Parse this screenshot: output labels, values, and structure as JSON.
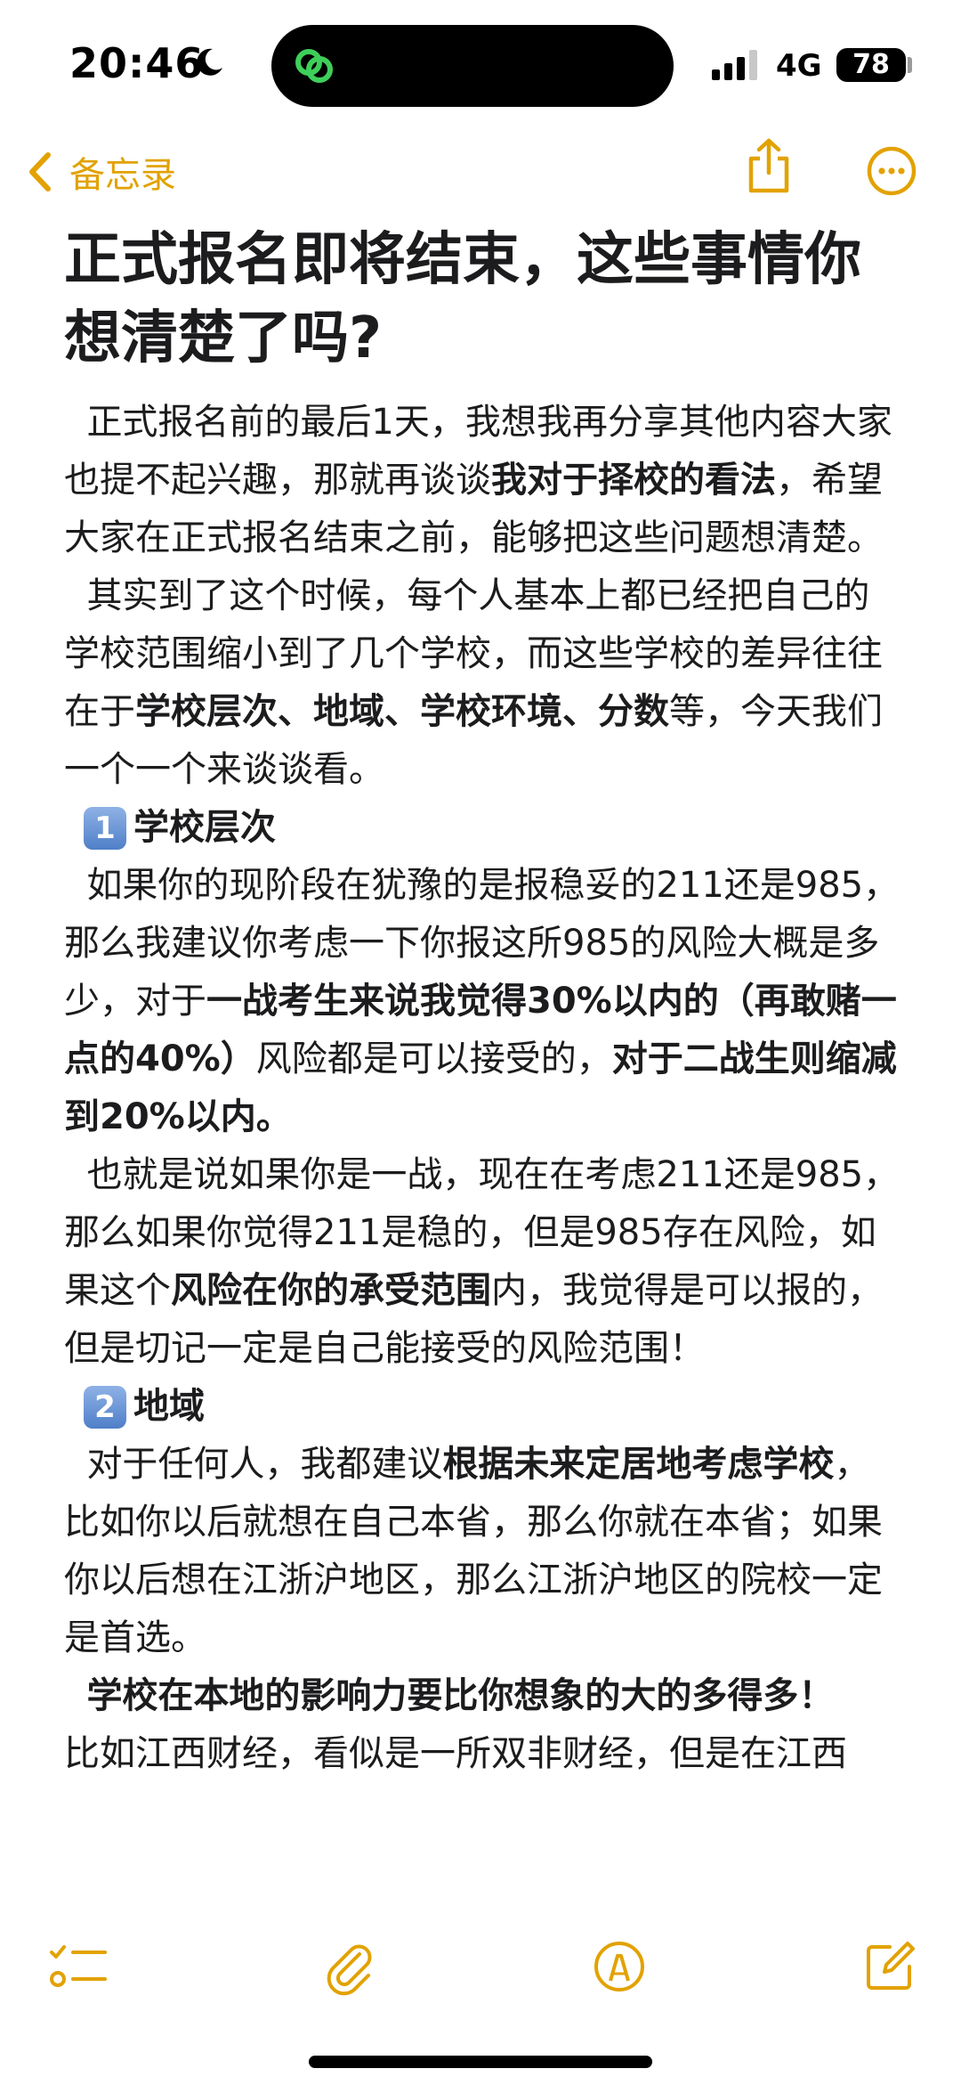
{
  "status_bar": {
    "time": "20:46",
    "network": "4G",
    "battery": "78"
  },
  "nav": {
    "back_label": "备忘录"
  },
  "note": {
    "title": "正式报名即将结束，这些事情你想清楚了吗?",
    "p1_a": "正式报名前的最后1天，我想我再分享其他内容大家也提不起兴趣，那就再谈谈",
    "p1_b": "我对于择校的看法",
    "p1_c": "，希望大家在正式报名结束之前，能够把这些问题想清楚。",
    "p2_a": "其实到了这个时候，每个人基本上都已经把自己的学校范围缩小到了几个学校，而这些学校的差异往往在于",
    "p2_b": "学校层次、地域、学校环境、分数",
    "p2_c": "等，今天我们一个一个来谈谈看。",
    "h1_num": "1",
    "h1_text": "学校层次",
    "p3_a": "如果你的现阶段在犹豫的是报稳妥的211还是985，那么我建议你考虑一下你报这所985的风险大概是多少，对于",
    "p3_b": "一战考生来说我觉得30%以内的（再敢赌一点的40%）",
    "p3_c": "风险都是可以接受的，",
    "p3_d": "对于二战生则缩减到20%以内。",
    "p4_a": "也就是说如果你是一战，现在在考虑211还是985，那么如果你觉得211是稳的，但是985存在风险，如果这个",
    "p4_b": "风险在你的承受范围",
    "p4_c": "内，我觉得是可以报的，但是切记一定是自己能接受的风险范围！",
    "h2_num": "2",
    "h2_text": "地域",
    "p5_a": "对于任何人，我都建议",
    "p5_b": "根据未来定居地考虑学校",
    "p5_c": "，比如你以后就想在自己本省，那么你就在本省；如果你以后想在江浙沪地区，那么江浙沪地区的院校一定是首选。",
    "p6_a": "学校在本地的影响力要比你想象的大的多得多！",
    "p6_b": "比如江西财经，看似是一所双非财经，但是在江西"
  },
  "colors": {
    "accent": "#e2a200",
    "text": "#1c1c1e",
    "keycap": "#5b8bd1"
  },
  "icons": [
    "moon-icon",
    "app-link-icon",
    "signal-icon",
    "chevron-left-icon",
    "share-icon",
    "more-icon",
    "checklist-icon",
    "paperclip-icon",
    "markup-icon",
    "compose-icon"
  ]
}
